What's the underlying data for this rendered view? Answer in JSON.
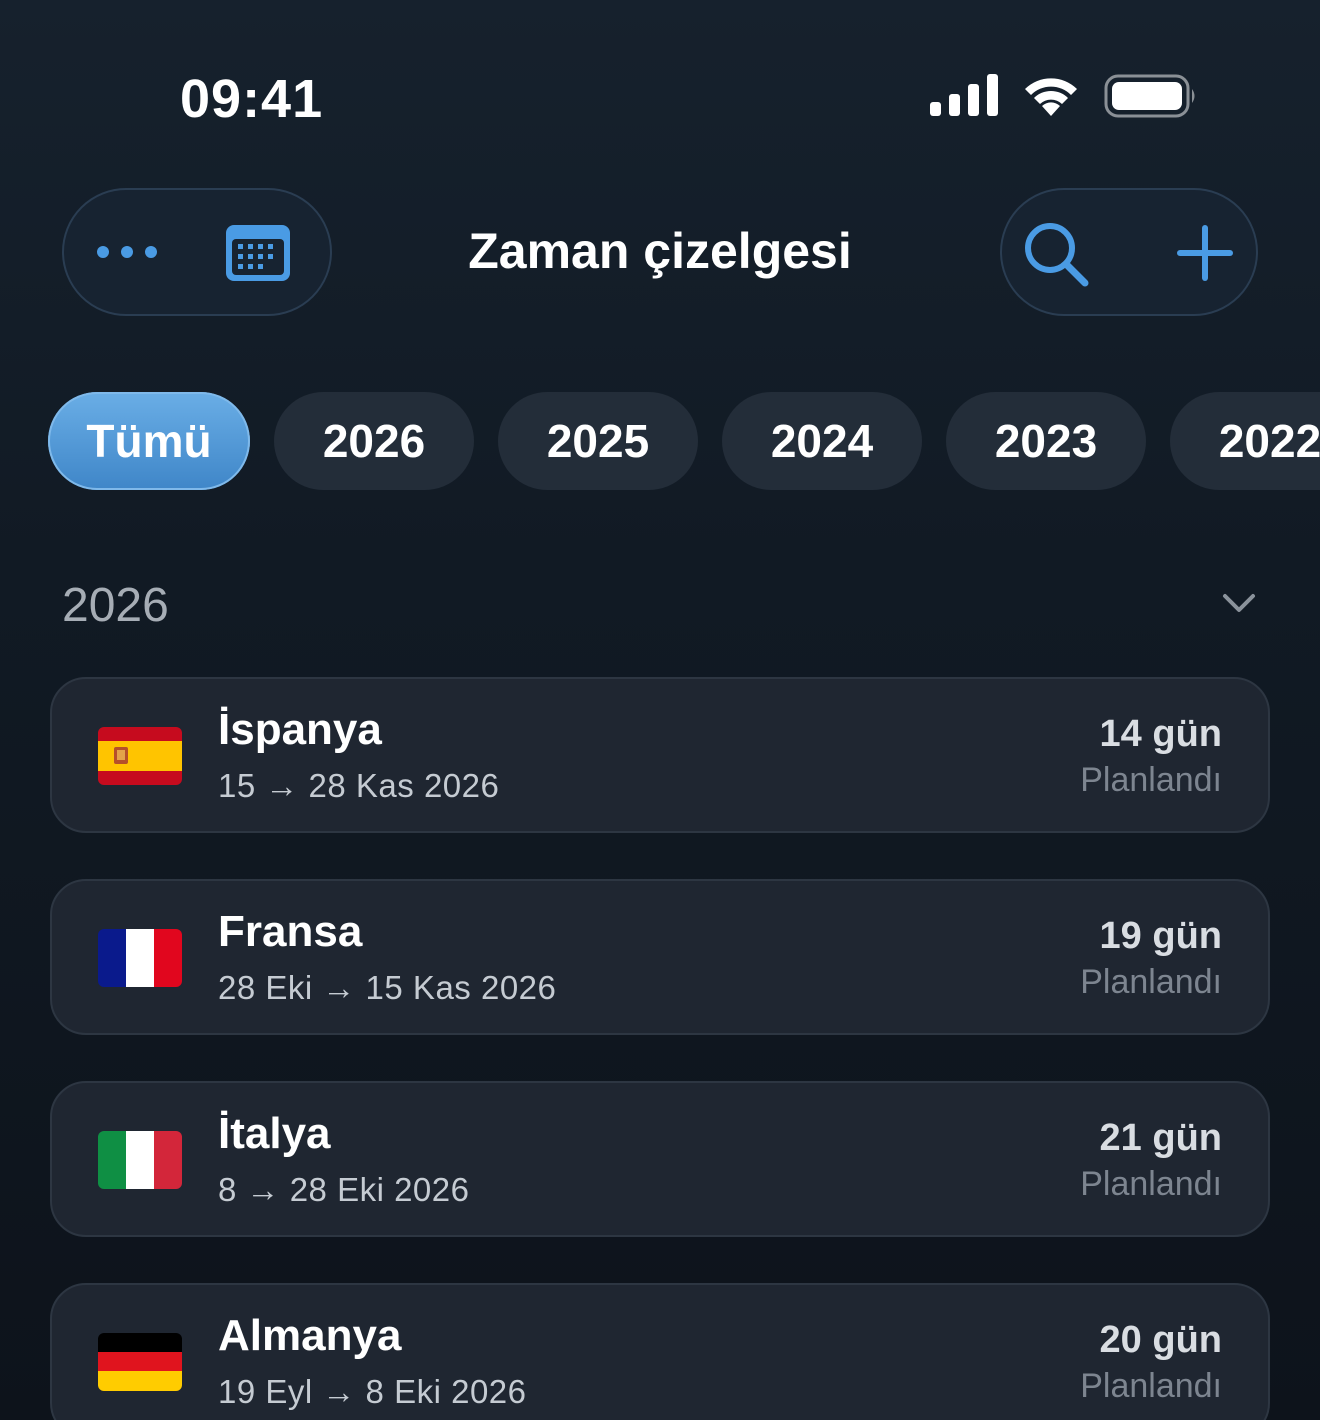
{
  "status_bar": {
    "time": "09:41",
    "icons": [
      "cellular-signal-icon",
      "wifi-icon",
      "battery-icon"
    ]
  },
  "header": {
    "title": "Zaman çizelgesi",
    "left_buttons": [
      "more-icon",
      "calendar-icon"
    ],
    "right_buttons": [
      "search-icon",
      "plus-icon"
    ],
    "accent_color": "#4a9be4"
  },
  "filters": {
    "chips": [
      {
        "label": "Tümü",
        "active": true
      },
      {
        "label": "2026",
        "active": false
      },
      {
        "label": "2025",
        "active": false
      },
      {
        "label": "2024",
        "active": false
      },
      {
        "label": "2023",
        "active": false
      },
      {
        "label": "2022",
        "active": false
      }
    ]
  },
  "section": {
    "year": "2026",
    "collapse_icon": "chevron-down-icon"
  },
  "trips": [
    {
      "country": "İspanya",
      "dates": "15 → 28 Kas 2026",
      "days": "14 gün",
      "status": "Planlandı",
      "flag": "spain-flag-icon"
    },
    {
      "country": "Fransa",
      "dates": "28 Eki → 15 Kas 2026",
      "days": "19 gün",
      "status": "Planlandı",
      "flag": "france-flag-icon"
    },
    {
      "country": "İtalya",
      "dates": "8 → 28 Eki 2026",
      "days": "21 gün",
      "status": "Planlandı",
      "flag": "italy-flag-icon"
    },
    {
      "country": "Almanya",
      "dates": "19 Eyl → 8 Eki 2026",
      "days": "20 gün",
      "status": "Planlandı",
      "flag": "germany-flag-icon"
    }
  ]
}
